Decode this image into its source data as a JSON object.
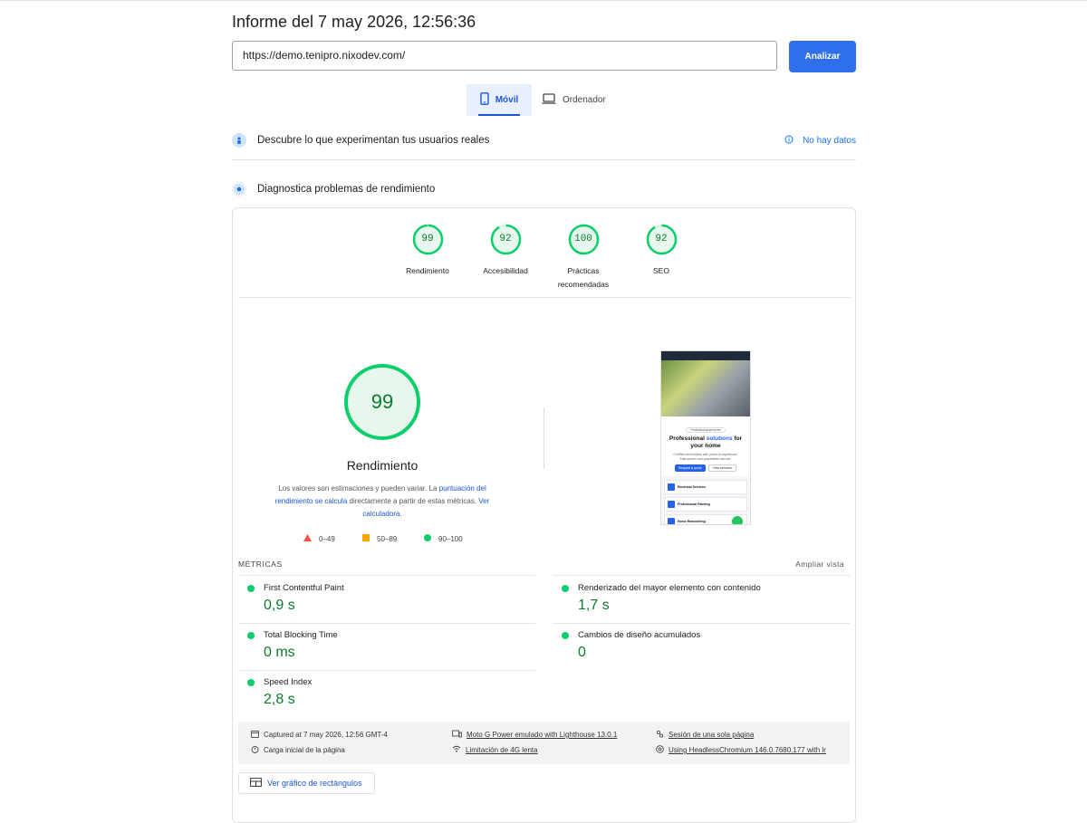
{
  "report": {
    "title": "Informe del 7 may 2026, 12:56:36"
  },
  "url_input": {
    "value": "https://demo.tenipro.nixodev.com/"
  },
  "analyze_button": {
    "label": "Analizar"
  },
  "device_tabs": [
    {
      "label": "Móvil",
      "icon": "smartphone-icon",
      "selected": true
    },
    {
      "label": "Ordenador",
      "icon": "laptop-icon",
      "selected": false
    }
  ],
  "field_data": {
    "label": "Descubre lo que experimentan tus usuarios reales",
    "status": "No hay datos"
  },
  "lab_data": {
    "label": "Diagnostica problemas de rendimiento"
  },
  "scores": [
    {
      "label": "Rendimiento",
      "value": 99
    },
    {
      "label": "Accesibilidad",
      "value": 92
    },
    {
      "label": "Prácticas recomendadas",
      "value": 100
    },
    {
      "label": "SEO",
      "value": 92
    }
  ],
  "performance": {
    "score": 99,
    "title": "Rendimiento",
    "desc_1": "Los valores son estimaciones y pueden variar. La",
    "desc_link_1": "puntuación del rendimiento se calcula",
    "desc_2": "directamente a partir de estas métricas.",
    "desc_link_2": "Ver calculadora",
    "desc_3": "."
  },
  "legend": [
    {
      "range": "0–49",
      "color": "#ff4e42",
      "shape": "triangle"
    },
    {
      "range": "50–89",
      "color": "#ffa400",
      "shape": "square"
    },
    {
      "range": "90–100",
      "color": "#0cce6b",
      "shape": "circle"
    }
  ],
  "metrics_section": {
    "heading": "MÉTRICAS",
    "expand": "Ampliar vista"
  },
  "metrics": [
    {
      "name": "First Contentful Paint",
      "value": "0,9 s"
    },
    {
      "name": "Renderizado del mayor elemento con contenido",
      "value": "1,7 s"
    },
    {
      "name": "Total Blocking Time",
      "value": "0 ms"
    },
    {
      "name": "Cambios de diseño acumulados",
      "value": "0"
    },
    {
      "name": "Speed Index",
      "value": "2,8 s"
    }
  ],
  "run_info": {
    "captured": "Captured at 7 may 2026, 12:56 GMT-4",
    "load": "Carga inicial de la página",
    "device": "Moto G Power emulado with Lighthouse 13.0.1",
    "throttling": "Limitación de 4G lenta",
    "session": "Sesión de una sola página",
    "browser": "Using HeadlessChromium 146.0.7680.177 with lr"
  },
  "treemap_button": {
    "label": "Ver gráfico de rectángulos"
  },
  "screenshot": {
    "badge": "Professional services",
    "headline_1": "Professional",
    "headline_accent": "solutions",
    "headline_2": "for your home",
    "sub": "Certified technicians with years of experience. Fast quotes and guaranteed service.",
    "btn_primary": "Request a quote",
    "btn_secondary": "View services",
    "services": [
      "Electrical Services",
      "Professional Painting",
      "Home Remodeling"
    ],
    "accent_color": "#2563eb"
  },
  "colors": {
    "pass": "#0cce6b",
    "pass_text": "#0c7a2f",
    "primary": "#2f6fec"
  }
}
